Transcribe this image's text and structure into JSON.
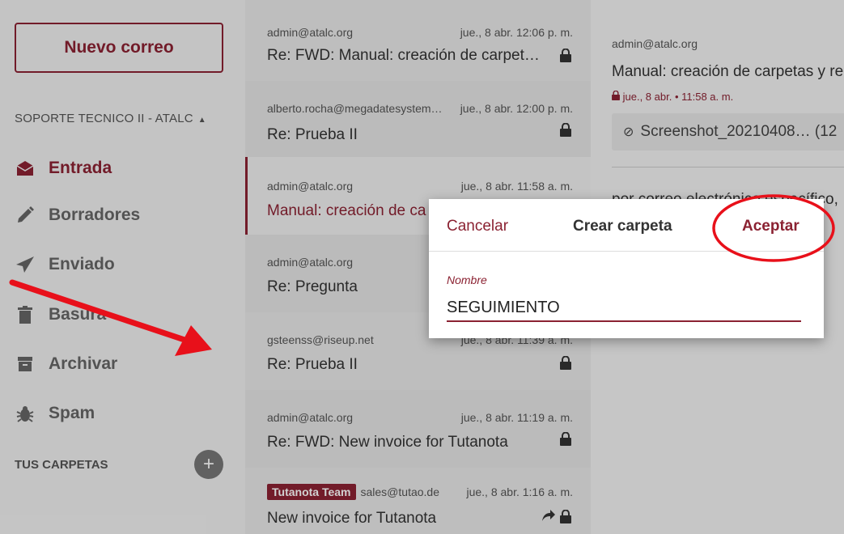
{
  "sidebar": {
    "new_mail": "Nuevo correo",
    "account": "SOPORTE TECNICO II - ATALC",
    "items": [
      {
        "label": "Entrada",
        "icon": "inbox-icon"
      },
      {
        "label": "Borradores",
        "icon": "pencil-icon"
      },
      {
        "label": "Enviado",
        "icon": "send-icon"
      },
      {
        "label": "Basura",
        "icon": "trash-icon"
      },
      {
        "label": "Archivar",
        "icon": "archive-icon"
      },
      {
        "label": "Spam",
        "icon": "bug-icon"
      }
    ],
    "folders_heading": "TUS CARPETAS",
    "add_folder": "+"
  },
  "mail_list": [
    {
      "from": "admin@atalc.org",
      "date": "jue., 8 abr. 12:06 p. m.",
      "subject": "Re: FWD: Manual: creación de carpet…"
    },
    {
      "from": "alberto.rocha@megadatesystem…",
      "date": "jue., 8 abr. 12:00 p. m.",
      "subject": "Re: Prueba II"
    },
    {
      "from": "admin@atalc.org",
      "date": "jue., 8 abr. 11:58 a. m.",
      "subject": "Manual: creación de ca"
    },
    {
      "from": "admin@atalc.org",
      "date": "",
      "subject": "Re: Pregunta"
    },
    {
      "from": "gsteenss@riseup.net",
      "date": "jue., 8 abr. 11:39 a. m.",
      "subject": "Re: Prueba II"
    },
    {
      "from": "admin@atalc.org",
      "date": "jue., 8 abr. 11:19 a. m.",
      "subject": "Re: FWD: New invoice for Tutanota"
    },
    {
      "tag": "Tutanota Team",
      "from": "sales@tutao.de",
      "date": "jue., 8 abr. 1:16 a. m.",
      "subject": "New invoice for Tutanota"
    }
  ],
  "preview": {
    "from": "admin@atalc.org",
    "subject": "Manual: creación de carpetas y re",
    "date": "jue., 8 abr. • 11:58 a. m.",
    "attachment": "Screenshot_20210408… (12",
    "body": "por correo electrónico específico,"
  },
  "dialog": {
    "cancel": "Cancelar",
    "title": "Crear carpeta",
    "ok": "Aceptar",
    "field_label": "Nombre",
    "field_value": "SEGUIMIENTO"
  },
  "colors": {
    "accent": "#8b2232",
    "annotation": "#e8101a"
  }
}
